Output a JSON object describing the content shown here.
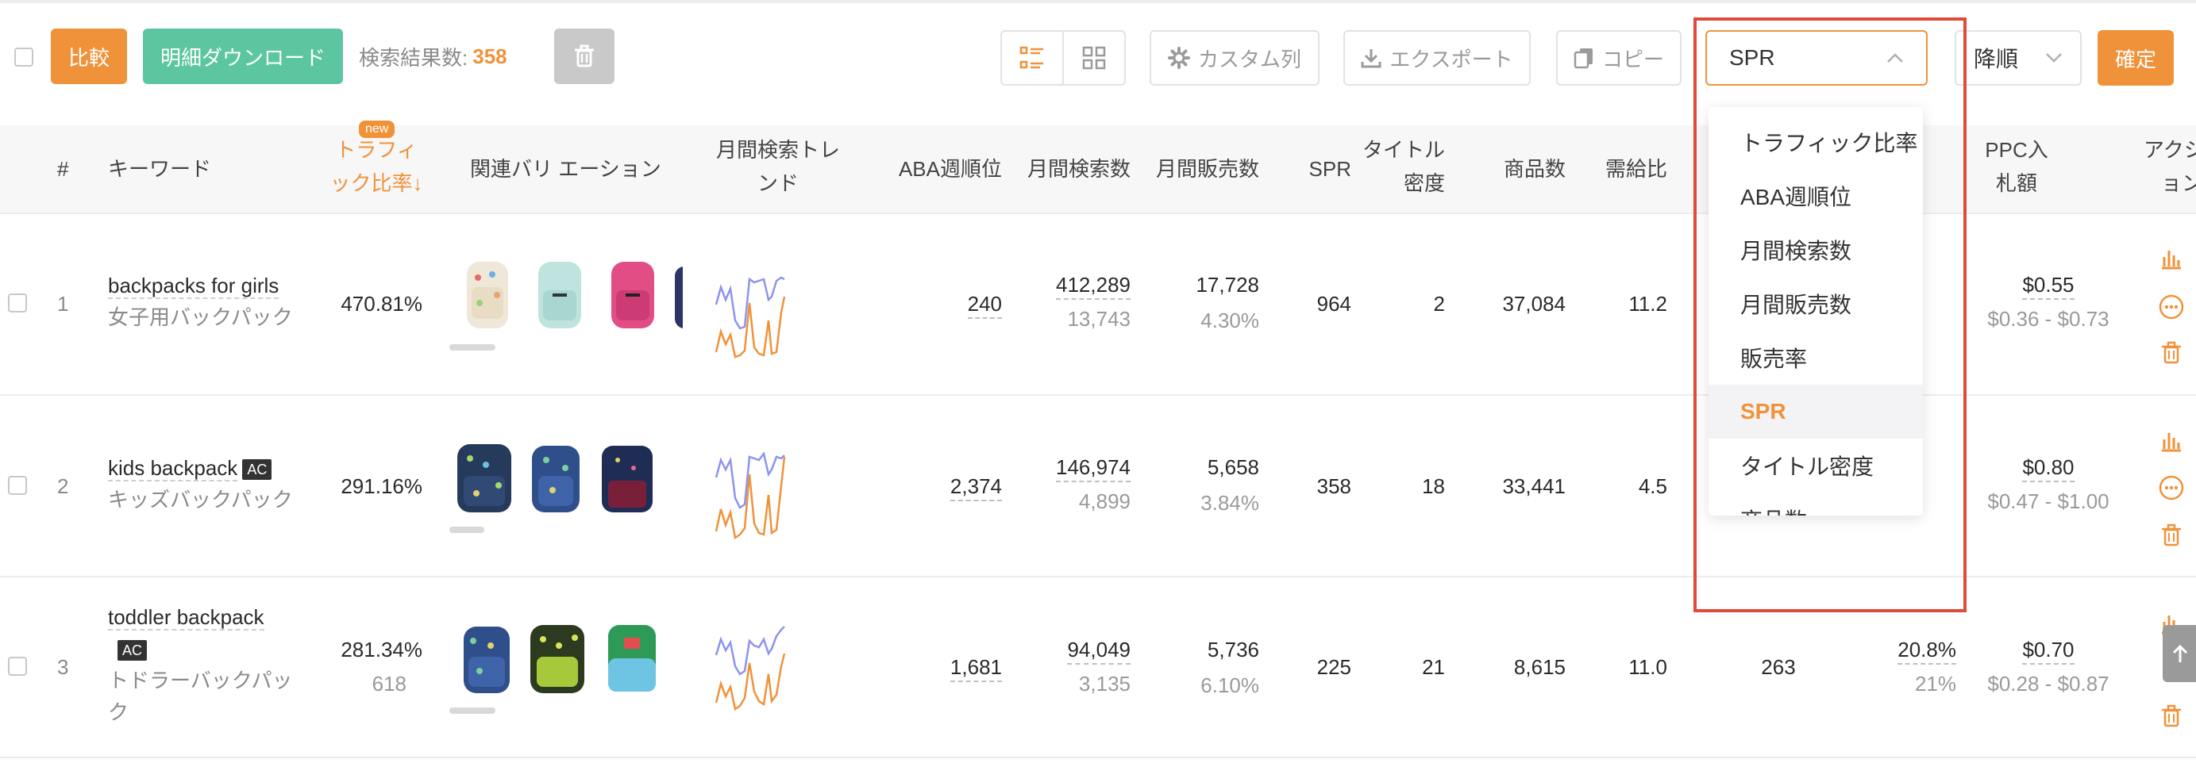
{
  "toolbar": {
    "compare_label": "比較",
    "download_label": "明細ダウンロード",
    "result_label": "検索結果数:",
    "result_count": "358",
    "custom_columns_label": "カスタム列",
    "export_label": "エクスポート",
    "copy_label": "コピー",
    "sort_field": "SPR",
    "sort_order": "降順",
    "confirm_label": "確定"
  },
  "sort_dropdown": {
    "options": [
      "トラフィック比率",
      "ABA週順位",
      "月間検索数",
      "月間販売数",
      "販売率",
      "SPR",
      "タイトル密度",
      "商品数"
    ],
    "selected": "SPR"
  },
  "columns": {
    "index": "#",
    "keyword": "キーワード",
    "new_badge": "new",
    "traffic_line1": "トラフィ",
    "traffic_line2": "ック比率↓",
    "variations": "関連バリ エーション",
    "trend_line1": "月間検索トレ",
    "trend_line2": "ンド",
    "aba": "ABA週順位",
    "monthly_search": "月間検索数",
    "monthly_sales": "月間販売数",
    "spr": "SPR",
    "title_density_line1": "タイトル",
    "title_density_line2": "密度",
    "products": "商品数",
    "supply_ratio": "需給比",
    "ppc_line1": "PPC入",
    "ppc_line2": "札額",
    "actions_line1": "アクシ",
    "actions_line2": "ョン"
  },
  "rows": [
    {
      "index": "1",
      "keyword_en": "backpacks for girls",
      "keyword_jp": "女子用バックパック",
      "ac": false,
      "traffic": "470.81%",
      "traffic_sub": "",
      "aba": "240",
      "search": "412,289",
      "search_sub": "13,743",
      "sales": "17,728",
      "sales_sub": "4.30%",
      "spr": "964",
      "title_density": "2",
      "products": "37,084",
      "supply_ratio": "11.2",
      "hidden_count": "",
      "hidden_pct": "",
      "hidden_pct_sub": "",
      "ppc": "$0.55",
      "ppc_range": "$0.36 - $0.73"
    },
    {
      "index": "2",
      "keyword_en": "kids backpack",
      "keyword_jp": "キッズバックパック",
      "ac": true,
      "ac_label": "AC",
      "traffic": "291.16%",
      "traffic_sub": "",
      "aba": "2,374",
      "search": "146,974",
      "search_sub": "4,899",
      "sales": "5,658",
      "sales_sub": "3.84%",
      "spr": "358",
      "title_density": "18",
      "products": "33,441",
      "supply_ratio": "4.5",
      "hidden_count": "",
      "hidden_pct": "",
      "hidden_pct_sub": "",
      "ppc": "$0.80",
      "ppc_range": "$0.47 - $1.00"
    },
    {
      "index": "3",
      "keyword_en": "toddler backpack",
      "keyword_jp_1": "トドラーバックパッ",
      "keyword_jp_2": "ク",
      "ac": true,
      "ac_label": "AC",
      "traffic": "281.34%",
      "traffic_sub": "618",
      "aba": "1,681",
      "search": "94,049",
      "search_sub": "3,135",
      "sales": "5,736",
      "sales_sub": "6.10%",
      "spr": "225",
      "title_density": "21",
      "products": "8,615",
      "supply_ratio": "11.0",
      "hidden_count": "263",
      "hidden_pct": "20.8%",
      "hidden_pct_sub": "21%",
      "ppc": "$0.70",
      "ppc_range": "$0.28 - $0.87"
    }
  ],
  "colors": {
    "accent": "#f0923a",
    "green": "#5cc6a0",
    "highlight_frame": "#e04a3a",
    "trend_blue": "#8c94f0",
    "trend_orange": "#f0923a"
  }
}
